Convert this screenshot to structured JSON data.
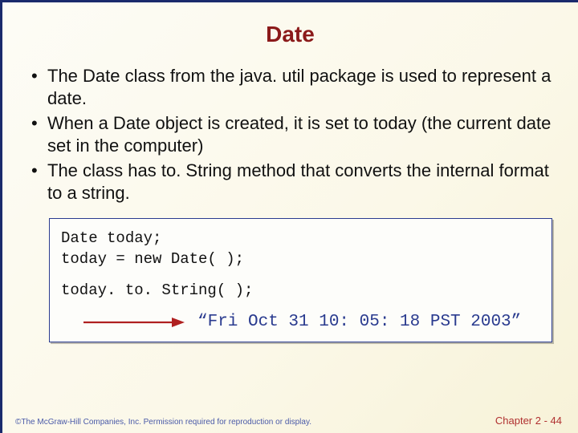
{
  "title": "Date",
  "bullets": [
    "The Date class from the java. util package is used to represent a date.",
    "When a Date object is created, it is set to today (the current date set in the computer)",
    "The class has to. String method that converts the internal format to a string."
  ],
  "code": {
    "line1": "Date today;",
    "line2": "today = new Date( );",
    "line3": "today. to. String( );",
    "output": "“Fri Oct 31 10: 05: 18 PST 2003”"
  },
  "footer": {
    "copyright": "©The McGraw-Hill Companies, Inc. Permission required for reproduction or display.",
    "chapter": "Chapter 2 - 44"
  },
  "colors": {
    "title": "#8b1a1a",
    "border": "#1a2a6c",
    "output": "#2a3b8f",
    "arrow": "#b02020"
  }
}
